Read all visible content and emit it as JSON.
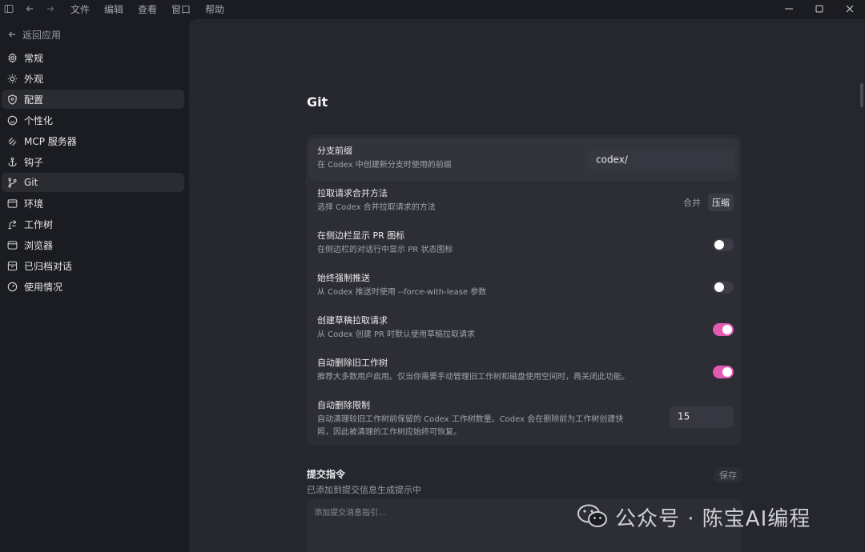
{
  "titlebar": {
    "menus": [
      "文件",
      "编辑",
      "查看",
      "窗口",
      "帮助"
    ]
  },
  "sidebar": {
    "back_label": "返回应用",
    "items": [
      {
        "label": "常规",
        "icon": "gear-icon"
      },
      {
        "label": "外观",
        "icon": "sun-icon"
      },
      {
        "label": "配置",
        "icon": "shield-icon"
      },
      {
        "label": "个性化",
        "icon": "smile-icon"
      },
      {
        "label": "MCP 服务器",
        "icon": "mcp-icon"
      },
      {
        "label": "钩子",
        "icon": "anchor-icon"
      },
      {
        "label": "Git",
        "icon": "git-branch-icon"
      },
      {
        "label": "环境",
        "icon": "terminal-icon"
      },
      {
        "label": "工作树",
        "icon": "worktree-icon"
      },
      {
        "label": "浏览器",
        "icon": "browser-icon"
      },
      {
        "label": "已归档对话",
        "icon": "archive-icon"
      },
      {
        "label": "使用情况",
        "icon": "gauge-icon"
      }
    ]
  },
  "page": {
    "title": "Git",
    "settings": [
      {
        "title": "分支前缀",
        "desc": "在 Codex 中创建新分支时使用的前缀",
        "control": "input",
        "value": "codex/"
      },
      {
        "title": "拉取请求合并方法",
        "desc": "选择 Codex 合并拉取请求的方法",
        "control": "segmented",
        "options": [
          "合并",
          "压缩"
        ],
        "selected": "压缩"
      },
      {
        "title": "在侧边栏显示 PR 图标",
        "desc": "在侧边栏的对话行中显示 PR 状态图标",
        "control": "toggle",
        "value": false
      },
      {
        "title": "始终强制推送",
        "desc": "从 Codex 推送时使用 --force-with-lease 参数",
        "control": "toggle",
        "value": false
      },
      {
        "title": "创建草稿拉取请求",
        "desc": "从 Codex 创建 PR 时默认使用草稿拉取请求",
        "control": "toggle",
        "value": true
      },
      {
        "title": "自动删除旧工作树",
        "desc": "推荐大多数用户启用。仅当你需要手动管理旧工作树和磁盘使用空间时，再关闭此功能。",
        "control": "toggle",
        "value": true
      },
      {
        "title": "自动删除限制",
        "desc": "自动清理较旧工作树前保留的 Codex 工作树数量。Codex 会在删除前为工作树创建快照，因此被清理的工作树应始终可恢复。",
        "control": "number",
        "value": "15"
      }
    ],
    "commit": {
      "title": "提交指令",
      "desc": "已添加到提交信息生成提示中",
      "save_label": "保存",
      "placeholder": "添加提交消息指引..."
    }
  },
  "watermark": {
    "text": "公众号 · 陈宝AI编程"
  },
  "colors": {
    "toggle_on": "#e35ab0",
    "panel_bg": "#26272e",
    "sidebar_bg": "#1b1c21"
  }
}
